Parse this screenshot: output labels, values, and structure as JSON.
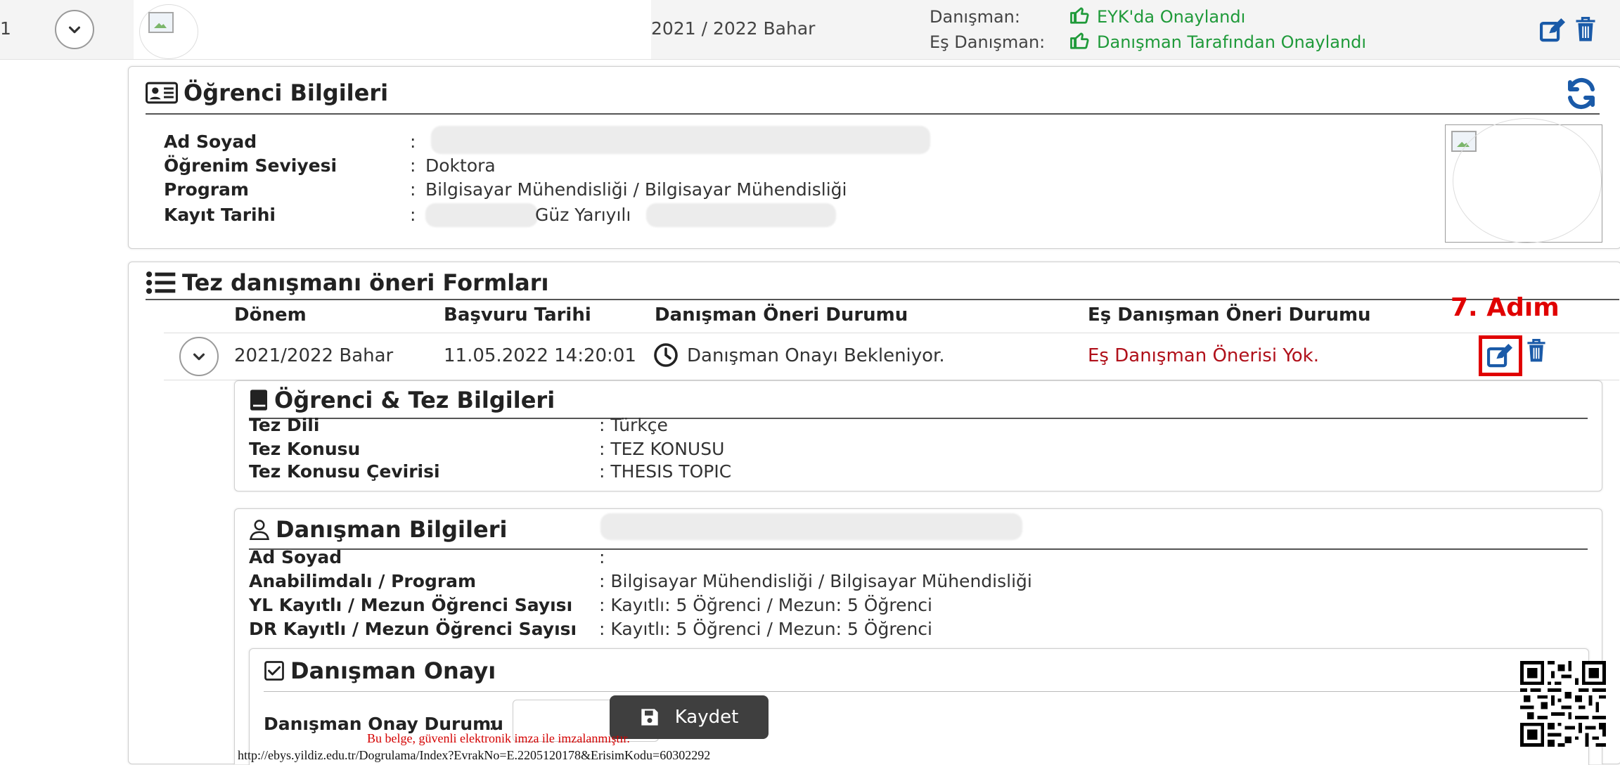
{
  "top_row": {
    "row_number": "1",
    "period": "2021 / 2022 Bahar",
    "advisor_label": "Danışman:",
    "advisor_status": "EYK'da Onaylandı",
    "co_advisor_label": "Eş Danışman:",
    "co_advisor_status": "Danışman Tarafından Onaylandı"
  },
  "student_panel": {
    "title": "Öğrenci Bilgileri",
    "fields": [
      {
        "label": "Ad Soyad",
        "value": ""
      },
      {
        "label": "Öğrenim Seviyesi",
        "value": "Doktora"
      },
      {
        "label": "Program",
        "value": "Bilgisayar Mühendisliği / Bilgisayar Mühendisliği"
      },
      {
        "label": "Kayıt Tarihi",
        "value": "Güz Yarıyılı"
      }
    ],
    "separator": ":"
  },
  "forms_panel": {
    "title": "Tez danışmanı öneri Formları",
    "columns": [
      "Dönem",
      "Başvuru Tarihi",
      "Danışman Öneri Durumu",
      "Eş Danışman Öneri Durumu"
    ],
    "row": {
      "period": "2021/2022 Bahar",
      "date": "11.05.2022 14:20:01",
      "advisor_status": "Danışman Onayı Bekleniyor.",
      "co_advisor_status": "Eş Danışman Önerisi Yok."
    },
    "step_annotation": "7. Adım",
    "accent_red": "#e00000"
  },
  "thesis_panel": {
    "title": "Öğrenci & Tez Bilgileri",
    "fields": [
      {
        "label": "Tez Dili",
        "value": ": Türkçe"
      },
      {
        "label": "Tez Konusu",
        "value": ": TEZ KONUSU"
      },
      {
        "label": "Tez Konusu Çevirisi",
        "value": ": THESIS TOPIC"
      }
    ]
  },
  "advisor_panel": {
    "title": "Danışman Bilgileri",
    "fields": [
      {
        "label": "Ad Soyad",
        "value": ":"
      },
      {
        "label": "Anabilimdalı / Program",
        "value": ": Bilgisayar Mühendisliği / Bilgisayar Mühendisliği"
      },
      {
        "label": "YL Kayıtlı / Mezun Öğrenci Sayısı",
        "value": ": Kayıtlı: 5 Öğrenci / Mezun: 5 Öğrenci"
      },
      {
        "label": "DR Kayıtlı / Mezun Öğrenci Sayısı",
        "value": ": Kayıtlı: 5 Öğrenci / Mezun: 5 Öğrenci"
      }
    ]
  },
  "approval_panel": {
    "title": "Danışman Onayı",
    "field_label": "Danışman Onay Durumu",
    "separator": ":",
    "save_label": "Kaydet"
  },
  "footer": {
    "signature_note": "Bu belge, güvenli elektronik imza ile imzalanmıştır.",
    "verify_url": "http://ebys.yildiz.edu.tr/Dogrulama/Index?EvrakNo=E.2205120178&ErisimKodu=60302292"
  },
  "icons": {
    "expand": "chevron-down-icon",
    "edit": "edit-icon",
    "delete": "trash-icon",
    "refresh": "refresh-icon",
    "approved": "thumbs-up-icon",
    "pending": "clock-icon",
    "id_card": "id-card-icon",
    "list": "list-icon",
    "book": "book-icon",
    "user": "user-icon",
    "checkbox": "check-square-icon",
    "save": "floppy-disk-icon",
    "qr": "qr-code-icon"
  },
  "colors": {
    "brand_blue": "#1a5aa8",
    "approved_green": "#1f9a3a",
    "status_red": "#b0101a"
  }
}
